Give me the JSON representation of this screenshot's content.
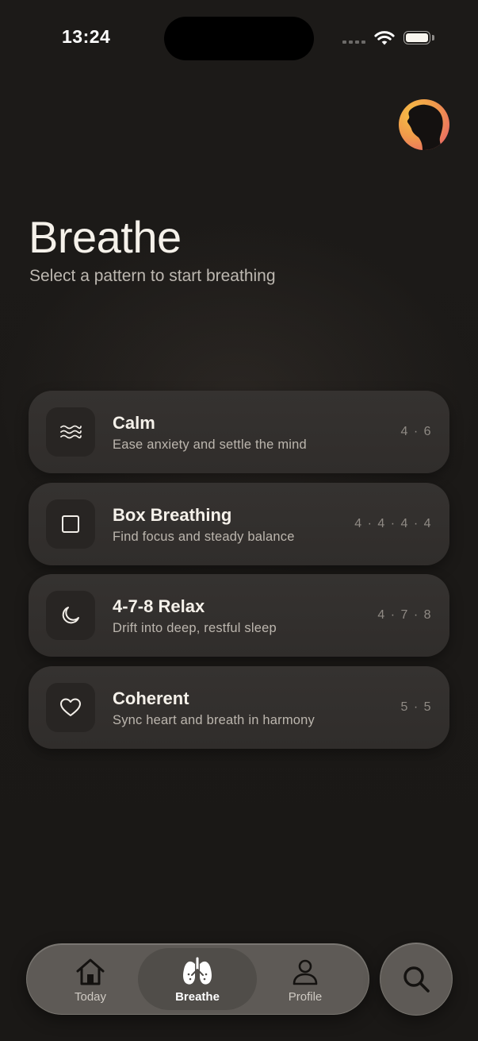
{
  "status_bar": {
    "time": "13:24"
  },
  "profile": {
    "avatar_icon": "profile-avatar"
  },
  "header": {
    "title": "Breathe",
    "subtitle": "Select a pattern to start breathing"
  },
  "patterns": [
    {
      "icon": "waves-icon",
      "title": "Calm",
      "description": "Ease anxiety and settle the mind",
      "pattern": "4 · 6"
    },
    {
      "icon": "square-icon",
      "title": "Box Breathing",
      "description": "Find focus and steady balance",
      "pattern": "4 · 4 · 4 · 4"
    },
    {
      "icon": "moon-icon",
      "title": "4-7-8 Relax",
      "description": "Drift into deep, restful sleep",
      "pattern": "4 · 7 · 8"
    },
    {
      "icon": "heart-icon",
      "title": "Coherent",
      "description": "Sync heart and breath in harmony",
      "pattern": "5 · 5"
    }
  ],
  "tab_bar": {
    "tabs": [
      {
        "label": "Today",
        "icon": "home-icon",
        "active": false
      },
      {
        "label": "Breathe",
        "icon": "lungs-icon",
        "active": true
      },
      {
        "label": "Profile",
        "icon": "person-icon",
        "active": false
      }
    ],
    "search_icon": "search-icon"
  },
  "colors": {
    "background": "#1b1917",
    "card": "#33302e",
    "icon_tile": "#282523",
    "text_primary": "#f5f1ea",
    "text_secondary": "#bcb6ae",
    "text_muted": "#8f8a84",
    "avatar_gradient": [
      "#f6c144",
      "#e6566f"
    ]
  }
}
